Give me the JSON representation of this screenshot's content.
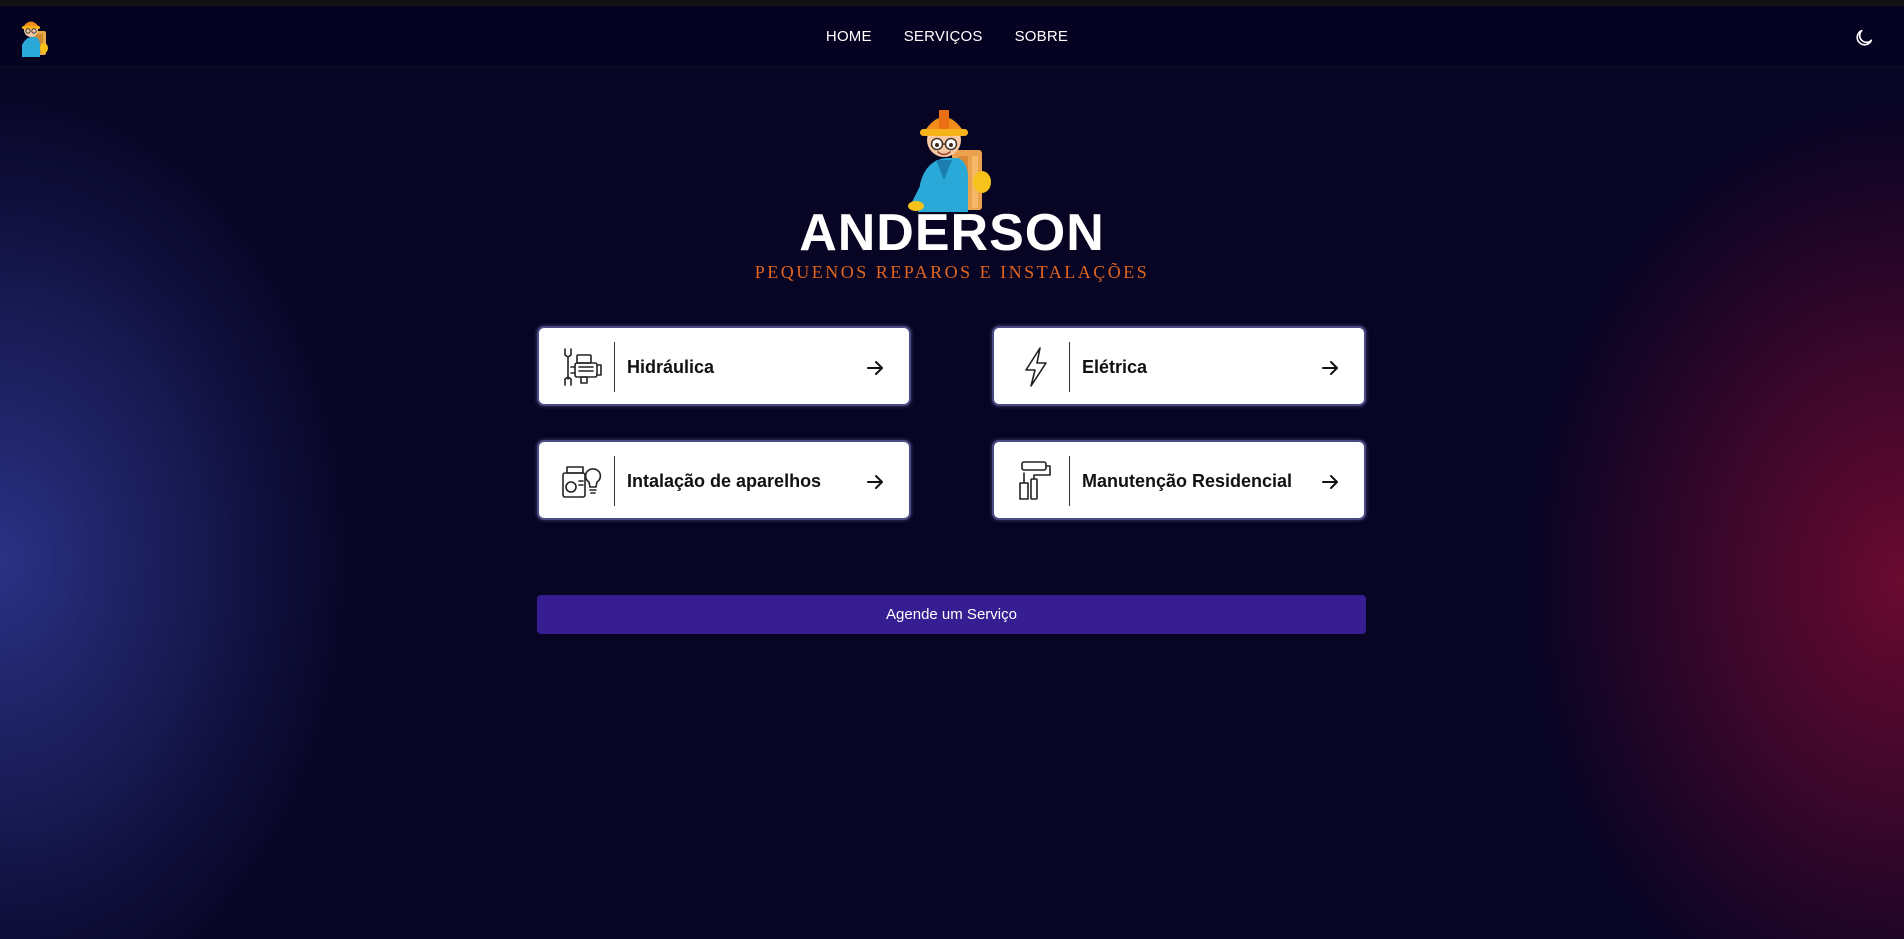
{
  "nav": {
    "links": [
      {
        "label": "HOME"
      },
      {
        "label": "SERVIÇOS"
      },
      {
        "label": "SOBRE"
      }
    ],
    "theme_toggle_icon": "moon-icon"
  },
  "hero": {
    "title": "ANDERSON",
    "subtitle": "PEQUENOS REPAROS E INSTALAÇÕES",
    "logo_icon": "handyman-mascot-icon"
  },
  "services": [
    {
      "label": "Hidráulica",
      "icon": "plumbing-tools-icon"
    },
    {
      "label": "Elétrica",
      "icon": "lightning-bolt-icon"
    },
    {
      "label": "Intalação de aparelhos",
      "icon": "appliances-icon"
    },
    {
      "label": "Manutenção Residencial",
      "icon": "paint-roller-icon"
    }
  ],
  "cta": {
    "label": "Agende um Serviço"
  },
  "colors": {
    "background": "#070424",
    "accent_orange": "#e0651f",
    "cta_purple": "#371d92",
    "card_border": "#4c4a84"
  }
}
